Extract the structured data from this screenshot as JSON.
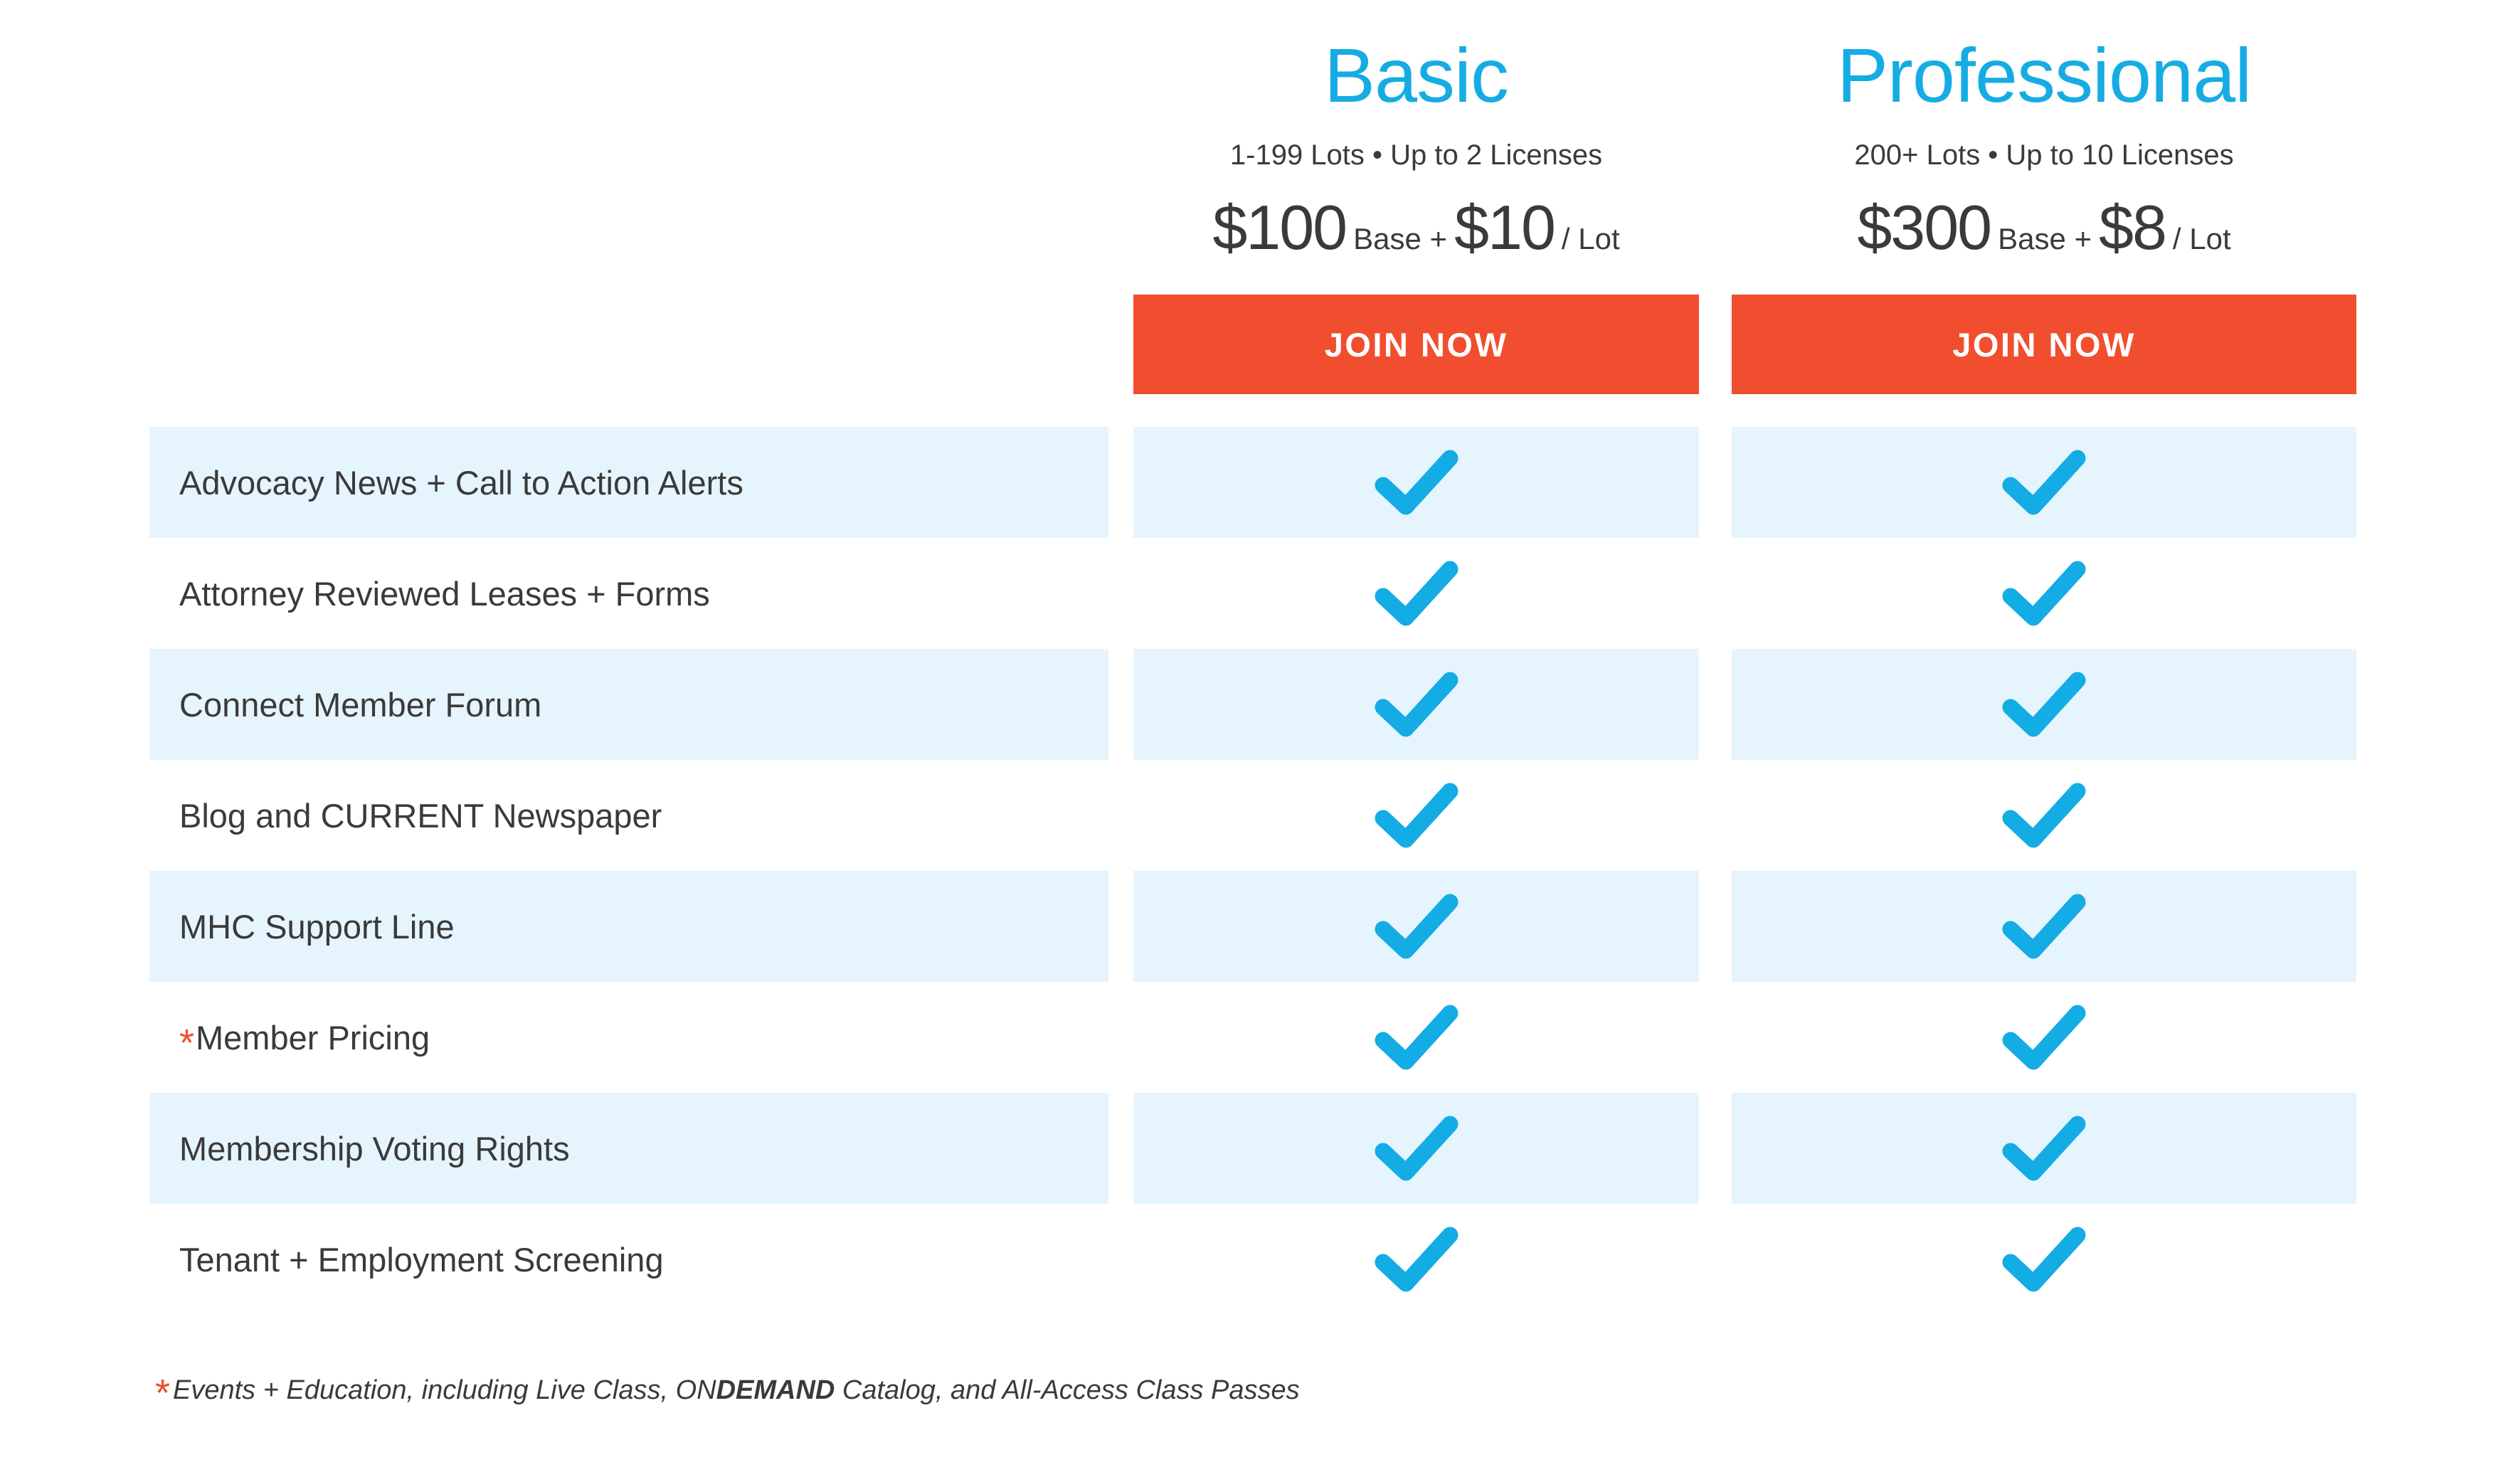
{
  "colors": {
    "plan_title": "#16ace3",
    "check": "#13ace4",
    "button_bg": "#f04e2e",
    "row_shade": "#e6f4fd",
    "text": "#3a3a3a",
    "star": "#f04e2e"
  },
  "plans": [
    {
      "id": "basic",
      "name": "Basic",
      "meta": "1-199 Lots  •  Up to 2 Licenses",
      "price_base_amount": "$100",
      "price_base_label": "Base +",
      "price_unit_amount": "$10",
      "price_unit_label": "/ Lot",
      "cta_label": "JOIN NOW"
    },
    {
      "id": "professional",
      "name": "Professional",
      "meta": "200+ Lots  •  Up to 10 Licenses",
      "price_base_amount": "$300",
      "price_base_label": "Base +",
      "price_unit_amount": "$8",
      "price_unit_label": "/ Lot",
      "cta_label": "JOIN NOW"
    }
  ],
  "features": [
    {
      "label": "Advocacy News + Call to Action Alerts",
      "starred": false,
      "basic": true,
      "professional": true
    },
    {
      "label": "Attorney Reviewed Leases + Forms",
      "starred": false,
      "basic": true,
      "professional": true
    },
    {
      "label": "Connect Member Forum",
      "starred": false,
      "basic": true,
      "professional": true
    },
    {
      "label": "Blog and CURRENT Newspaper",
      "starred": false,
      "basic": true,
      "professional": true
    },
    {
      "label": "MHC Support Line",
      "starred": false,
      "basic": true,
      "professional": true
    },
    {
      "label": "Member Pricing",
      "starred": true,
      "basic": true,
      "professional": true
    },
    {
      "label": "Membership Voting Rights",
      "starred": false,
      "basic": true,
      "professional": true
    },
    {
      "label": "Tenant + Employment Screening",
      "starred": false,
      "basic": true,
      "professional": true
    }
  ],
  "footnote": {
    "star": "*",
    "text_before": "Events + Education, including Live Class, ON",
    "text_bold": "DEMAND",
    "text_after": " Catalog, and All-Access Class Passes"
  },
  "icons": {
    "check": "check-icon",
    "star": "asterisk-icon"
  }
}
